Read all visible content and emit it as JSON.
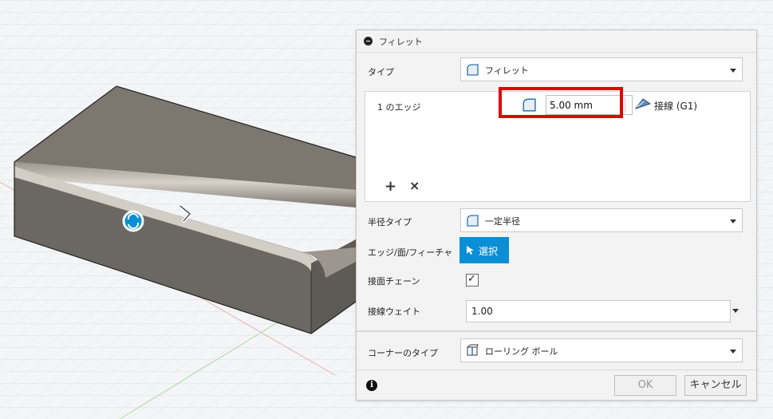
{
  "dialog": {
    "title": "フィレット",
    "type": {
      "label": "タイプ",
      "value": "フィレット"
    },
    "edges": {
      "count_label": "1 のエッジ",
      "radius_value": "5.00 mm",
      "tangent_label": "接線 (G1)",
      "add_symbol": "+",
      "remove_symbol": "×"
    },
    "radius_type": {
      "label": "半径タイプ",
      "value": "一定半径"
    },
    "edge_face_feature": {
      "label": "エッジ/面/フィーチャ",
      "button": "選択"
    },
    "tangent_chain": {
      "label": "接面チェーン",
      "checked": true,
      "mark": "✓"
    },
    "tangent_weight": {
      "label": "接線ウェイト",
      "value": "1.00"
    },
    "corner_type": {
      "label": "コーナーのタイプ",
      "value": "ローリング ボール"
    },
    "info_symbol": "i",
    "ok_label": "OK",
    "cancel_label": "キャンセル"
  },
  "colors": {
    "accent": "#0a8fd6",
    "highlight": "#e30000",
    "model_top": "#7d776f",
    "model_side": "#6b6761"
  },
  "icons": [
    "fillet-shape-icon",
    "tangent-icon",
    "cursor-icon",
    "caret-down-icon",
    "info-icon",
    "rolling-ball-icon",
    "rotate-handle-icon",
    "arrow-handle-icon"
  ]
}
